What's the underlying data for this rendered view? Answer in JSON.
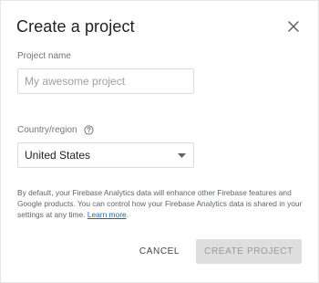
{
  "dialog": {
    "title": "Create a project",
    "close_icon": "close-icon"
  },
  "project_name": {
    "label": "Project name",
    "value": "",
    "placeholder": "My awesome project"
  },
  "country": {
    "label": "Country/region",
    "help_icon": "help-circle-icon",
    "selected": "United States",
    "dropdown_icon": "caret-down-icon"
  },
  "disclaimer": {
    "text": "By default, your Firebase Analytics data will enhance other Firebase features and Google products. You can control how your Firebase Analytics data is shared in your settings at any time.",
    "link_text": "Learn more",
    "end": "."
  },
  "actions": {
    "cancel_label": "CANCEL",
    "create_label": "CREATE PROJECT"
  },
  "colors": {
    "link": "#1565c0",
    "disabled_button_bg": "#dedede",
    "disabled_button_text": "#9a9a9a"
  }
}
